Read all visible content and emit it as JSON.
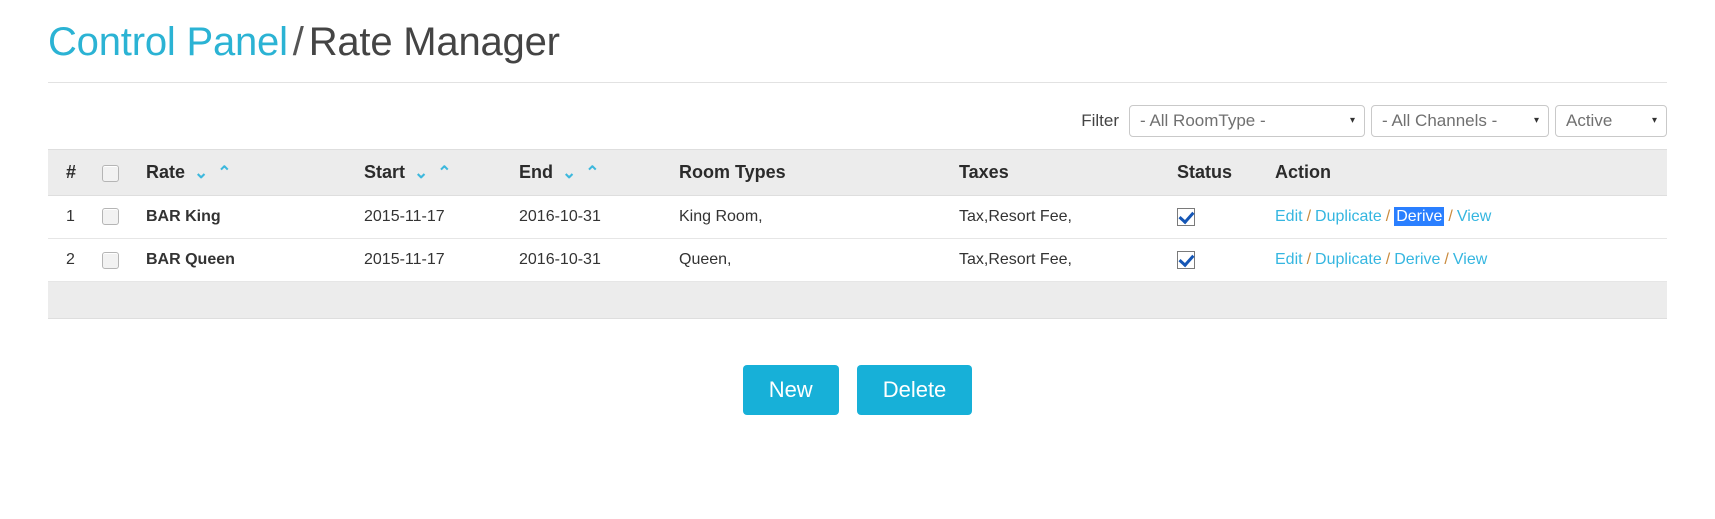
{
  "breadcrumb": {
    "link_label": "Control Panel",
    "separator": "/",
    "current_label": "Rate Manager"
  },
  "filter": {
    "label": "Filter",
    "room_type_value": "- All RoomType -",
    "channels_value": "- All Channels -",
    "status_value": "Active",
    "arrow_glyph": "▾"
  },
  "table": {
    "headers": {
      "num": "#",
      "rate": "Rate",
      "start": "Start",
      "end": "End",
      "room_types": "Room Types",
      "taxes": "Taxes",
      "status": "Status",
      "action": "Action"
    },
    "sort_icons": {
      "down": "⌄",
      "up": "⌃"
    },
    "rows": [
      {
        "num": "1",
        "rate": "BAR King",
        "start": "2015-11-17",
        "end": "2016-10-31",
        "room_types": "King Room,",
        "taxes": "Tax,Resort Fee,",
        "status_checked": true,
        "actions": [
          "Edit",
          "Duplicate",
          "Derive",
          "View"
        ],
        "selected_action": "Derive"
      },
      {
        "num": "2",
        "rate": "BAR Queen",
        "start": "2015-11-17",
        "end": "2016-10-31",
        "room_types": "Queen,",
        "taxes": "Tax,Resort Fee,",
        "status_checked": true,
        "actions": [
          "Edit",
          "Duplicate",
          "Derive",
          "View"
        ],
        "selected_action": null
      }
    ],
    "action_separator": "/"
  },
  "buttons": {
    "new_label": "New",
    "delete_label": "Delete"
  },
  "colors": {
    "accent": "#17b0d8",
    "link": "#35b6e0",
    "selection": "#2a7fff",
    "header_bg": "#ececec"
  }
}
